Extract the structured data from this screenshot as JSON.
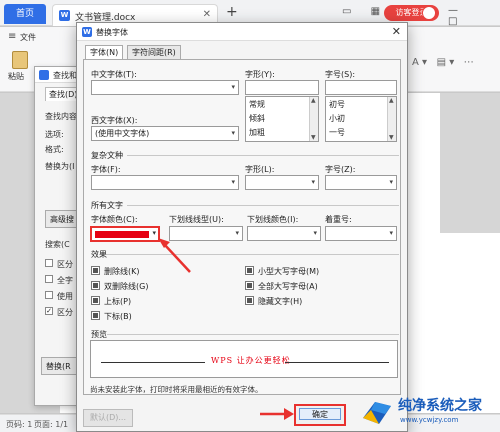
{
  "titlebar": {
    "home_tab": "首页",
    "doc_tab": "文书管理.docx",
    "new_tab": "+",
    "login": "访客登录",
    "window_controls": "— □ ✕",
    "badge": "2"
  },
  "ribbon": {
    "file_menu": "文件",
    "paste_label": "粘贴"
  },
  "find_dialog": {
    "title": "查找和",
    "tab": "查找(D)",
    "content_label": "查找内容",
    "options_label": "选项:",
    "format_label": "格式:",
    "replace_label": "替换为(I",
    "advanced_button": "高级搜",
    "search_label": "搜索(C",
    "checks": [
      {
        "label": "区分",
        "checked": false
      },
      {
        "label": "全字",
        "checked": false
      },
      {
        "label": "使用",
        "checked": false
      },
      {
        "label": "区分",
        "checked": true
      }
    ],
    "replace_button": "替换(R"
  },
  "dialog": {
    "title": "替换字体",
    "close": "✕",
    "tabs": [
      "字体(N)",
      "字符间距(R)"
    ],
    "chinese_font_label": "中文字体(T):",
    "western_font_label": "西文字体(X):",
    "western_font_value": "(使用中文字体)",
    "style_label": "字形(Y):",
    "size_label": "字号(S):",
    "styles": [
      "常规",
      "倾斜",
      "加粗"
    ],
    "sizes": [
      "初号",
      "小初",
      "一号"
    ],
    "complex_section": "复杂文种",
    "font_label": "字体(F):",
    "style_label2": "字形(L):",
    "size_label2": "字号(Z):",
    "all_text_section": "所有文字",
    "font_color_label": "字体颜色(C):",
    "underline_style_label": "下划线线型(U):",
    "underline_color_label": "下划线颜色(I):",
    "emphasis_label": "着重号:",
    "font_color": "#e60012",
    "effects_section": "效果",
    "effects_left": [
      "删除线(K)",
      "双删除线(G)",
      "上标(P)",
      "下标(B)"
    ],
    "effects_right": [
      "小型大写字母(M)",
      "全部大写字母(A)",
      "隐藏文字(H)"
    ],
    "preview_section": "预览",
    "preview_text": "WPS 让办公更轻松",
    "note": "尚未安装此字体，打印时将采用最相近的有效字体。",
    "default_button": "默认(D)...",
    "ok_button": "确定"
  },
  "statusbar": {
    "page": "页码: 1",
    "pages": "页面: 1/1"
  },
  "watermark": {
    "name": "纯净系统之家",
    "url": "www.ycwjzy.com"
  }
}
